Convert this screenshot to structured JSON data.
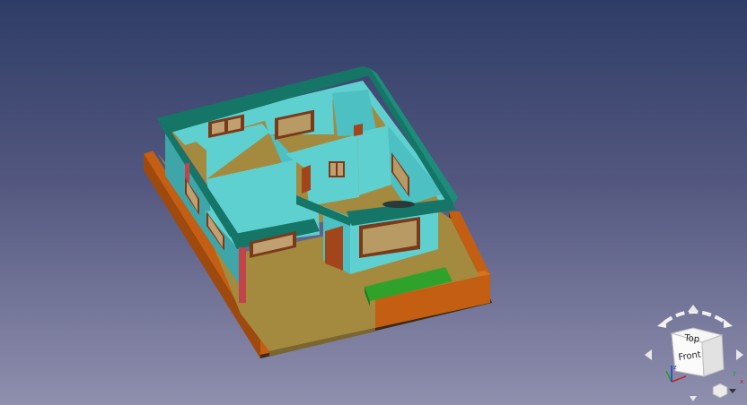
{
  "viewport": {
    "background_top": "#2e3d67",
    "background_bottom": "#8f8fae"
  },
  "navcube": {
    "face_top": "Top",
    "face_front": "Front",
    "axis_x": "x",
    "axis_y": "y",
    "axis_z": "z",
    "axis_colors": {
      "x": "#c02020",
      "y": "#20a020",
      "z": "#2040c0"
    }
  },
  "model": {
    "colors": {
      "wall": "#5fd0d0",
      "wall_dark": "#3ea6a8",
      "roof_band": "#157566",
      "floor": "#a48a3f",
      "compound_wall": "#c35e12",
      "planter": "#2ea22a",
      "column": "#c2434a",
      "door": "#a3451a",
      "window_frame": "#7a3a1a"
    }
  }
}
